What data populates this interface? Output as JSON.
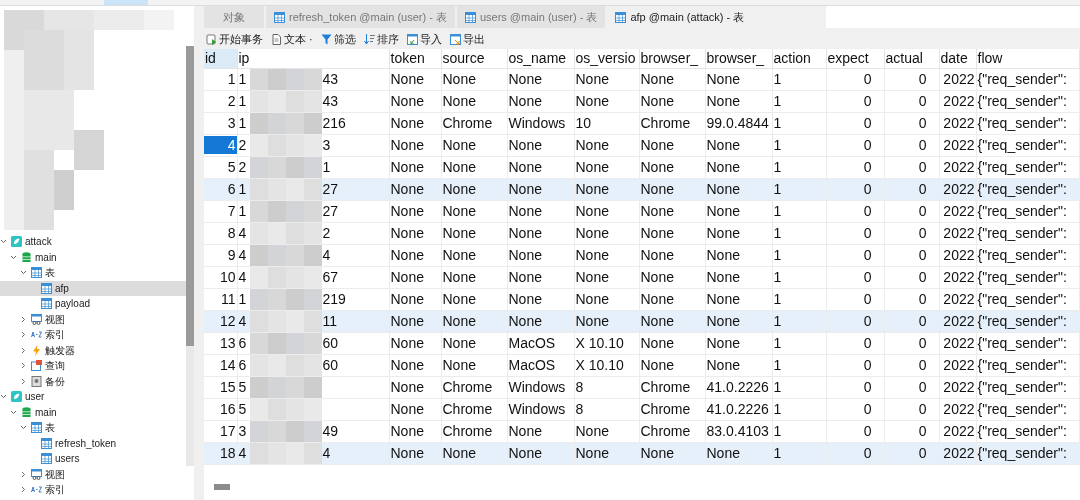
{
  "tabs": [
    {
      "label": "对象",
      "kind": "plain",
      "selected": false
    },
    {
      "label": "refresh_token @main (user) - 表",
      "kind": "table",
      "selected": false
    },
    {
      "label": "users @main (user) - 表",
      "kind": "table",
      "selected": false
    },
    {
      "label": "afp @main (attack) - 表",
      "kind": "table",
      "selected": true
    }
  ],
  "toolbar": [
    {
      "label": "开始事务",
      "kind": "transaction"
    },
    {
      "label": "文本 ·",
      "kind": "text"
    },
    {
      "label": "筛选",
      "kind": "filter"
    },
    {
      "label": "排序",
      "kind": "sort"
    },
    {
      "label": "导入",
      "kind": "import"
    },
    {
      "label": "导出",
      "kind": "export"
    }
  ],
  "sidebar": {
    "items": [
      {
        "label": "attack",
        "kind": "connection",
        "expanded": true,
        "children": [
          {
            "label": "main",
            "kind": "database",
            "expanded": true,
            "children": [
              {
                "label": "表",
                "kind": "tables",
                "expanded": true,
                "children": [
                  {
                    "label": "afp",
                    "kind": "table",
                    "selected": true
                  },
                  {
                    "label": "payload",
                    "kind": "table",
                    "selected": false
                  }
                ]
              },
              {
                "label": "视图",
                "kind": "views",
                "expanded": false
              },
              {
                "label": "索引",
                "kind": "index",
                "expanded": false
              },
              {
                "label": "触发器",
                "kind": "trigger",
                "expanded": false
              },
              {
                "label": "查询",
                "kind": "query",
                "expanded": false
              },
              {
                "label": "备份",
                "kind": "backup",
                "expanded": false
              }
            ]
          }
        ]
      },
      {
        "label": "user",
        "kind": "connection",
        "expanded": true,
        "children": [
          {
            "label": "main",
            "kind": "database",
            "expanded": true,
            "children": [
              {
                "label": "表",
                "kind": "tables",
                "expanded": true,
                "children": [
                  {
                    "label": "refresh_token",
                    "kind": "table",
                    "selected": false
                  },
                  {
                    "label": "users",
                    "kind": "table",
                    "selected": false
                  }
                ]
              },
              {
                "label": "视图",
                "kind": "views",
                "expanded": false
              },
              {
                "label": "索引",
                "kind": "index",
                "expanded": false
              }
            ]
          }
        ]
      }
    ]
  },
  "table": {
    "columns": [
      "id",
      "ip",
      "token",
      "source",
      "os_name",
      "os_versio",
      "browser_",
      "browser_",
      "action",
      "expect",
      "actual",
      "date",
      "flow"
    ],
    "rows": [
      {
        "selected": false,
        "highlighted": false,
        "ip_prefix": "1",
        "cells": [
          "1",
          "43",
          "None",
          "None",
          "None",
          "None",
          "None",
          "None",
          "1",
          "0",
          "0",
          "2022",
          "{\"req_sender\":"
        ]
      },
      {
        "selected": false,
        "highlighted": false,
        "ip_prefix": "1",
        "cells": [
          "2",
          "43",
          "None",
          "None",
          "None",
          "None",
          "None",
          "None",
          "1",
          "0",
          "0",
          "2022",
          "{\"req_sender\":"
        ]
      },
      {
        "selected": false,
        "highlighted": false,
        "ip_prefix": "1",
        "cells": [
          "3",
          "216",
          "None",
          "Chrome",
          "Windows",
          "10",
          "Chrome",
          "99.0.4844",
          "1",
          "0",
          "0",
          "2022",
          "{\"req_sender\":"
        ]
      },
      {
        "selected": true,
        "highlighted": false,
        "ip_prefix": "2",
        "cells": [
          "4",
          "3",
          "None",
          "None",
          "None",
          "None",
          "None",
          "None",
          "1",
          "0",
          "0",
          "2022",
          "{\"req_sender\":"
        ]
      },
      {
        "selected": false,
        "highlighted": false,
        "ip_prefix": "2",
        "cells": [
          "5",
          "1",
          "None",
          "None",
          "None",
          "None",
          "None",
          "None",
          "1",
          "0",
          "0",
          "2022",
          "{\"req_sender\":"
        ]
      },
      {
        "selected": false,
        "highlighted": true,
        "ip_prefix": "1",
        "cells": [
          "6",
          "27",
          "None",
          "None",
          "None",
          "None",
          "None",
          "None",
          "1",
          "0",
          "0",
          "2022",
          "{\"req_sender\":"
        ]
      },
      {
        "selected": false,
        "highlighted": false,
        "ip_prefix": "1",
        "cells": [
          "7",
          "27",
          "None",
          "None",
          "None",
          "None",
          "None",
          "None",
          "1",
          "0",
          "0",
          "2022",
          "{\"req_sender\":"
        ]
      },
      {
        "selected": false,
        "highlighted": false,
        "ip_prefix": "4",
        "cells": [
          "8",
          "2",
          "None",
          "None",
          "None",
          "None",
          "None",
          "None",
          "1",
          "0",
          "0",
          "2022",
          "{\"req_sender\":"
        ]
      },
      {
        "selected": false,
        "highlighted": false,
        "ip_prefix": "4",
        "cells": [
          "9",
          "4",
          "None",
          "None",
          "None",
          "None",
          "None",
          "None",
          "1",
          "0",
          "0",
          "2022",
          "{\"req_sender\":"
        ]
      },
      {
        "selected": false,
        "highlighted": false,
        "ip_prefix": "4",
        "cells": [
          "10",
          "67",
          "None",
          "None",
          "None",
          "None",
          "None",
          "None",
          "1",
          "0",
          "0",
          "2022",
          "{\"req_sender\":"
        ]
      },
      {
        "selected": false,
        "highlighted": false,
        "ip_prefix": "1",
        "cells": [
          "11",
          "219",
          "None",
          "None",
          "None",
          "None",
          "None",
          "None",
          "1",
          "0",
          "0",
          "2022",
          "{\"req_sender\":"
        ]
      },
      {
        "selected": false,
        "highlighted": true,
        "ip_prefix": "4",
        "cells": [
          "12",
          "11",
          "None",
          "None",
          "None",
          "None",
          "None",
          "None",
          "1",
          "0",
          "0",
          "2022",
          "{\"req_sender\":"
        ]
      },
      {
        "selected": false,
        "highlighted": false,
        "ip_prefix": "6",
        "cells": [
          "13",
          "60",
          "None",
          "None",
          "MacOS",
          "X 10.10",
          "None",
          "None",
          "1",
          "0",
          "0",
          "2022",
          "{\"req_sender\":"
        ]
      },
      {
        "selected": false,
        "highlighted": false,
        "ip_prefix": "6",
        "cells": [
          "14",
          "60",
          "None",
          "None",
          "MacOS",
          "X 10.10",
          "None",
          "None",
          "1",
          "0",
          "0",
          "2022",
          "{\"req_sender\":"
        ]
      },
      {
        "selected": false,
        "highlighted": false,
        "ip_prefix": "5",
        "cells": [
          "15",
          "",
          "None",
          "Chrome",
          "Windows",
          "8",
          "Chrome",
          "41.0.2226",
          "1",
          "0",
          "0",
          "2022",
          "{\"req_sender\":"
        ]
      },
      {
        "selected": false,
        "highlighted": false,
        "ip_prefix": "5",
        "cells": [
          "16",
          "",
          "None",
          "Chrome",
          "Windows",
          "8",
          "Chrome",
          "41.0.2226",
          "1",
          "0",
          "0",
          "2022",
          "{\"req_sender\":"
        ]
      },
      {
        "selected": false,
        "highlighted": false,
        "ip_prefix": "3",
        "cells": [
          "17",
          "49",
          "None",
          "Chrome",
          "None",
          "None",
          "Chrome",
          "83.0.4103",
          "1",
          "0",
          "0",
          "2022",
          "{\"req_sender\":"
        ]
      },
      {
        "selected": false,
        "highlighted": true,
        "ip_prefix": "4",
        "cells": [
          "18",
          "4",
          "None",
          "None",
          "None",
          "None",
          "None",
          "None",
          "1",
          "0",
          "0",
          "2022",
          "{\"req_sender\":"
        ]
      }
    ]
  }
}
